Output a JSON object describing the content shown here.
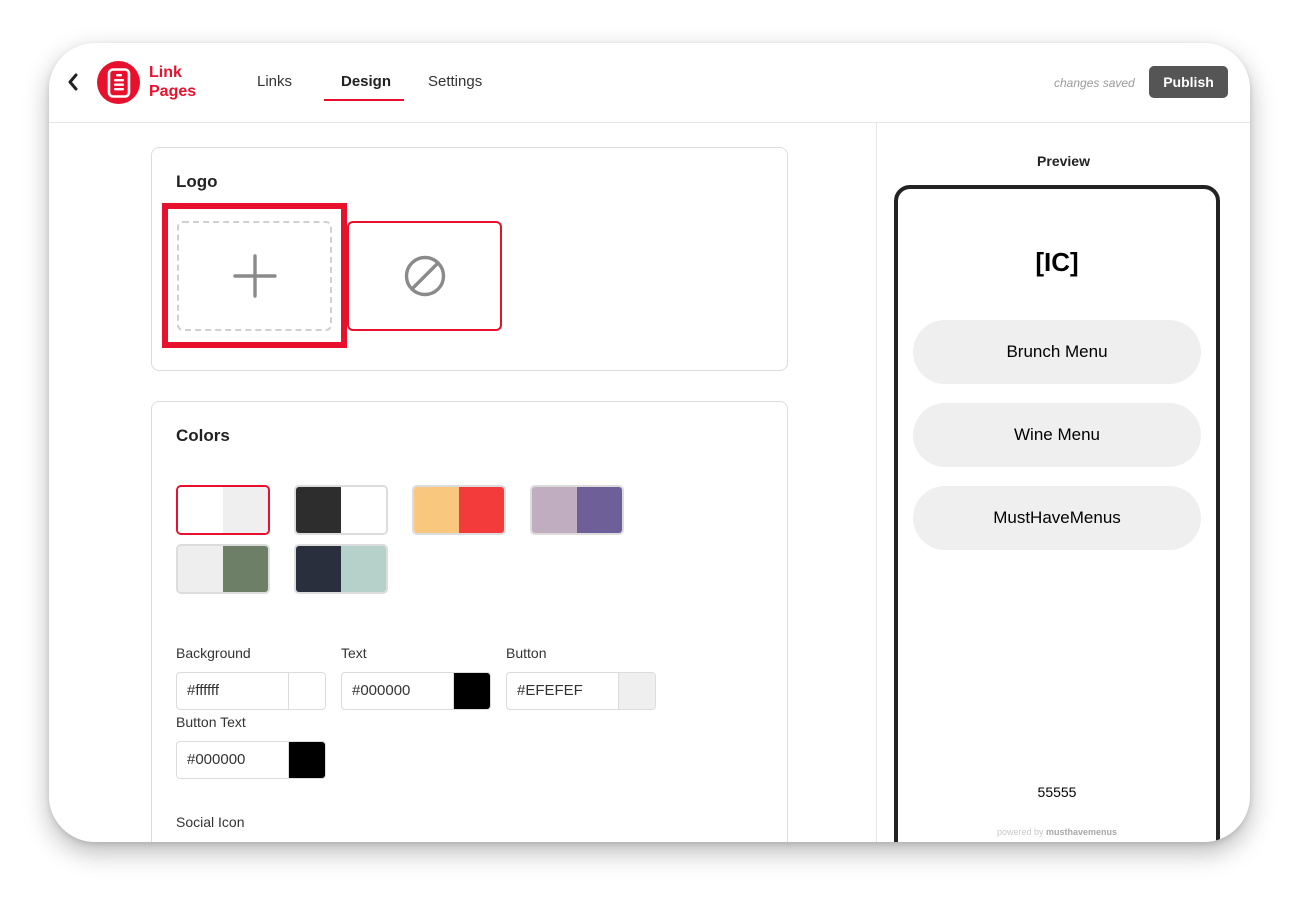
{
  "header": {
    "brand_line1": "Link",
    "brand_line2": "Pages",
    "tabs": [
      {
        "label": "Links"
      },
      {
        "label": "Design"
      },
      {
        "label": "Settings"
      }
    ],
    "status": "changes saved",
    "publish_label": "Publish"
  },
  "logo_section": {
    "title": "Logo",
    "upload_icon": "plus-icon",
    "none_icon": "no-symbol-icon"
  },
  "colors_section": {
    "title": "Colors",
    "presets": [
      {
        "colors": [
          "#ffffff",
          "#efefef"
        ],
        "selected": true
      },
      {
        "colors": [
          "#2d2d2d",
          "#ffffff"
        ],
        "selected": false
      },
      {
        "colors": [
          "#f9c87e",
          "#f43b3b"
        ],
        "selected": false
      },
      {
        "colors": [
          "#c0adc0",
          "#6e5f99"
        ],
        "selected": false
      },
      {
        "colors": [
          "#eeeeee",
          "#6e7f67"
        ],
        "selected": false
      },
      {
        "colors": [
          "#2a2f3e",
          "#b5d1ca"
        ],
        "selected": false
      }
    ],
    "background_label": "Background",
    "background_value": "#ffffff",
    "text_label": "Text",
    "text_value": "#000000",
    "button_label": "Button",
    "button_value": "#EFEFEF",
    "button_text_label": "Button Text",
    "button_text_value": "#000000",
    "social_icon_label": "Social Icon"
  },
  "preview": {
    "title": "Preview",
    "logo_text": "[IC]",
    "buttons": [
      {
        "label": "Brunch Menu"
      },
      {
        "label": "Wine Menu"
      },
      {
        "label": "MustHaveMenus"
      }
    ],
    "footer_text": "55555",
    "powered_prefix": "powered by",
    "powered_brand": "musthavemenus"
  },
  "colors": {
    "accent": "#e8112d",
    "publish_bg": "#555555",
    "preview_button": "#efefef"
  }
}
